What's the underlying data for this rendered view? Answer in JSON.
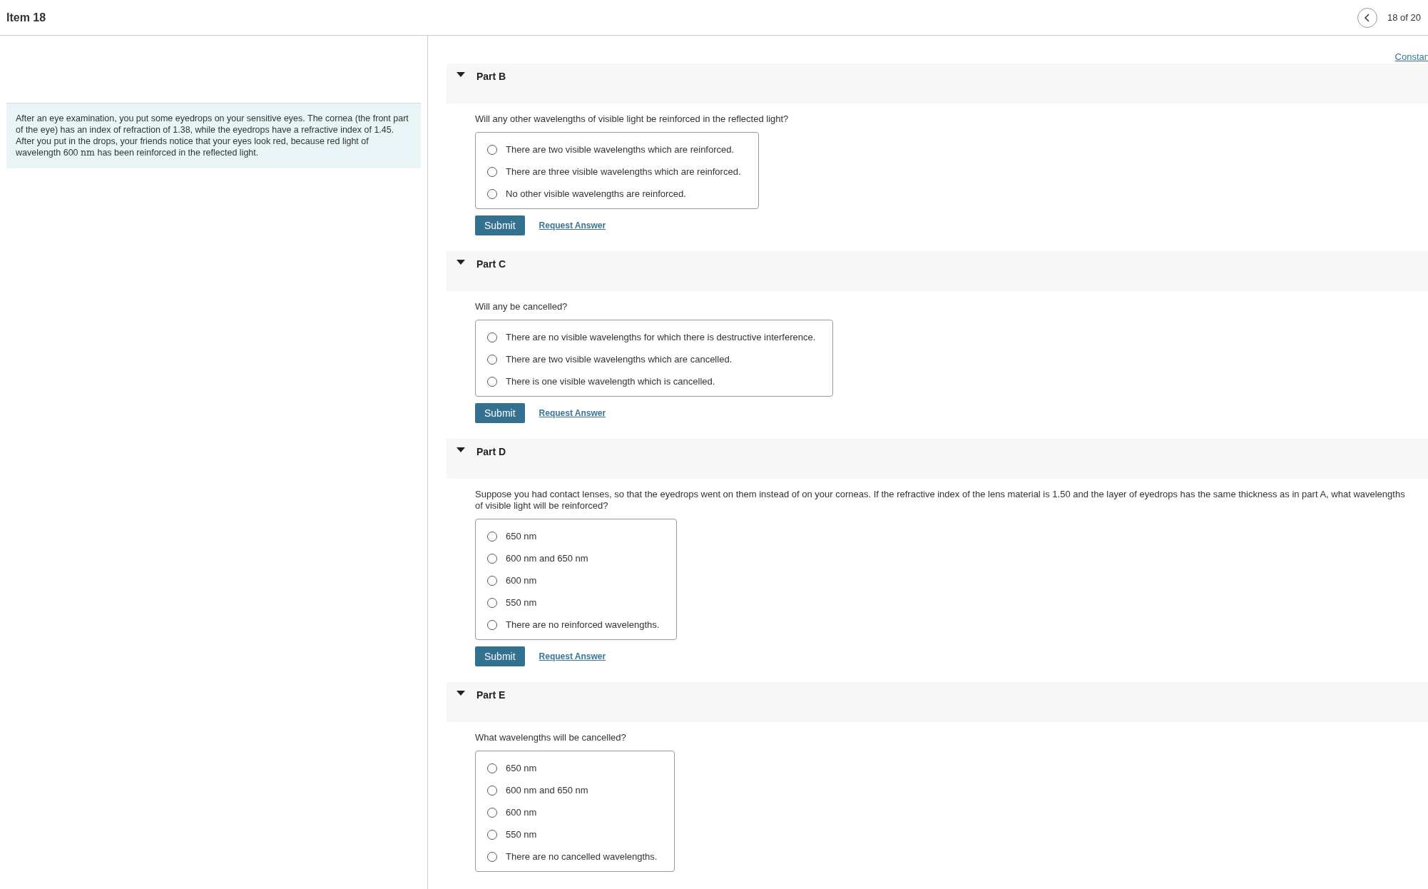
{
  "header": {
    "title": "Item 18",
    "pager": "18 of 20"
  },
  "intro": {
    "before": "After an eye examination, you put some eyedrops on your sensitive eyes. The cornea (the front part of the eye) has an index of refraction of 1.38, while the eyedrops have a refractive index of 1.45. After you put in the drops, your friends notice that your eyes look red, because red light of wavelength 600 ",
    "unit": "nm",
    "after": " has been reinforced in the reflected light."
  },
  "constants_link": "Constan",
  "parts": [
    {
      "title": "Part B",
      "expanded": true,
      "question": "Will any other wavelengths of visible light be reinforced in the reflected light?",
      "options": [
        {
          "label": "There are two visible wavelengths which are reinforced.",
          "selected": false
        },
        {
          "label": "There are three visible wavelengths which are reinforced.",
          "selected": false
        },
        {
          "label": "No other visible wavelengths are reinforced.",
          "selected": false
        }
      ],
      "submit": "Submit",
      "request": "Request Answer"
    },
    {
      "title": "Part C",
      "expanded": true,
      "question": "Will any be cancelled?",
      "options": [
        {
          "label": "There are no visible wavelengths for which there is destructive interference.",
          "selected": false
        },
        {
          "label": "There are two visible wavelengths which are cancelled.",
          "selected": false
        },
        {
          "label": "There is one visible wavelength which is cancelled.",
          "selected": false
        }
      ],
      "submit": "Submit",
      "request": "Request Answer"
    },
    {
      "title": "Part D",
      "expanded": true,
      "question": "Suppose you had contact lenses, so that the eyedrops went on them instead of on your corneas. If the refractive index of the lens material is 1.50 and the layer of eyedrops has the same thickness as in part A, what wavelengths of visible light will be reinforced?",
      "options": [
        {
          "label": "650 nm",
          "selected": false
        },
        {
          "label": "600 nm and 650 nm",
          "selected": false
        },
        {
          "label": "600 nm",
          "selected": false
        },
        {
          "label": "550 nm",
          "selected": false
        },
        {
          "label": "There are no reinforced wavelengths.",
          "selected": false
        }
      ],
      "submit": "Submit",
      "request": "Request Answer"
    },
    {
      "title": "Part E",
      "expanded": true,
      "question": "What wavelengths will be cancelled?",
      "options": [
        {
          "label": "650 nm",
          "selected": false
        },
        {
          "label": "600 nm and 650 nm",
          "selected": false
        },
        {
          "label": "600 nm",
          "selected": false
        },
        {
          "label": "550 nm",
          "selected": false
        },
        {
          "label": "There are no cancelled wavelengths.",
          "selected": false
        }
      ]
    }
  ]
}
